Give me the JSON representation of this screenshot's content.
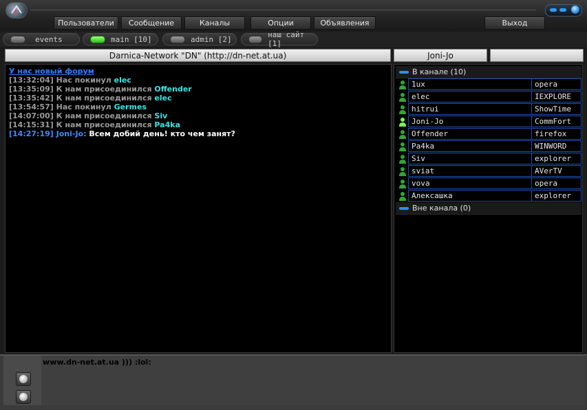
{
  "menu": {
    "users": "Пользователи",
    "message": "Сообщение",
    "channels": "Каналы",
    "options": "Опции",
    "ads": "Объявления",
    "exit": "Выход"
  },
  "tabs": [
    {
      "label": "events",
      "active": false
    },
    {
      "label": "main [10]",
      "active": true
    },
    {
      "label": "admin [2]",
      "active": false
    },
    {
      "label": "наш сайт [1]",
      "active": false
    }
  ],
  "channel_title": "Darnica-Network \"DN\" (http://dn-net.at.ua)",
  "current_user": "Joni-Jo",
  "chat": {
    "forum_link": "У нас новый форум",
    "lines": [
      {
        "time": "[13:32:04]",
        "text": "Нас покинул",
        "nick": "elec"
      },
      {
        "time": "[13:35:09]",
        "text": "К нам присоединился",
        "nick": "Offender"
      },
      {
        "time": "[13:35:42]",
        "text": "К нам присоединился",
        "nick": "elec"
      },
      {
        "time": "[13:54:57]",
        "text": "Нас покинул",
        "nick": "Germes"
      },
      {
        "time": "[14:07:00]",
        "text": "К нам присоединился",
        "nick": "Siv"
      },
      {
        "time": "[14:15:31]",
        "text": "К нам присоединился",
        "nick": "Pa4ka"
      }
    ],
    "my_message": {
      "time": "[14:27:19]",
      "nick": "Joni-Jo:",
      "text": "Всем добий день! кто чем занят?"
    }
  },
  "users": {
    "in_channel": "В канале (10)",
    "out_channel": "Вне канала (0)",
    "list": [
      {
        "name": "1ux",
        "client": "opera",
        "active": false
      },
      {
        "name": "elec",
        "client": "IEXPLORE",
        "active": false
      },
      {
        "name": "hitrui",
        "client": "ShowTime",
        "active": false
      },
      {
        "name": "Joni-Jo",
        "client": "CommFort",
        "active": true
      },
      {
        "name": "Offender",
        "client": "firefox",
        "active": false
      },
      {
        "name": "Pa4ka",
        "client": "WINWORD",
        "active": false
      },
      {
        "name": "Siv",
        "client": "explorer",
        "active": false
      },
      {
        "name": "sviat",
        "client": "AVerTV",
        "active": false
      },
      {
        "name": "vova",
        "client": "opera",
        "active": false
      },
      {
        "name": "Алексашка",
        "client": "explorer",
        "active": false
      }
    ]
  },
  "input_text": "www.dn-net.at.ua ))) :lol:",
  "colors": {
    "accent_blue": "#2a8cff",
    "nick_cyan": "#36e6e6",
    "user_icon_green": "#2fa82f",
    "active_led": "#25c20e"
  }
}
